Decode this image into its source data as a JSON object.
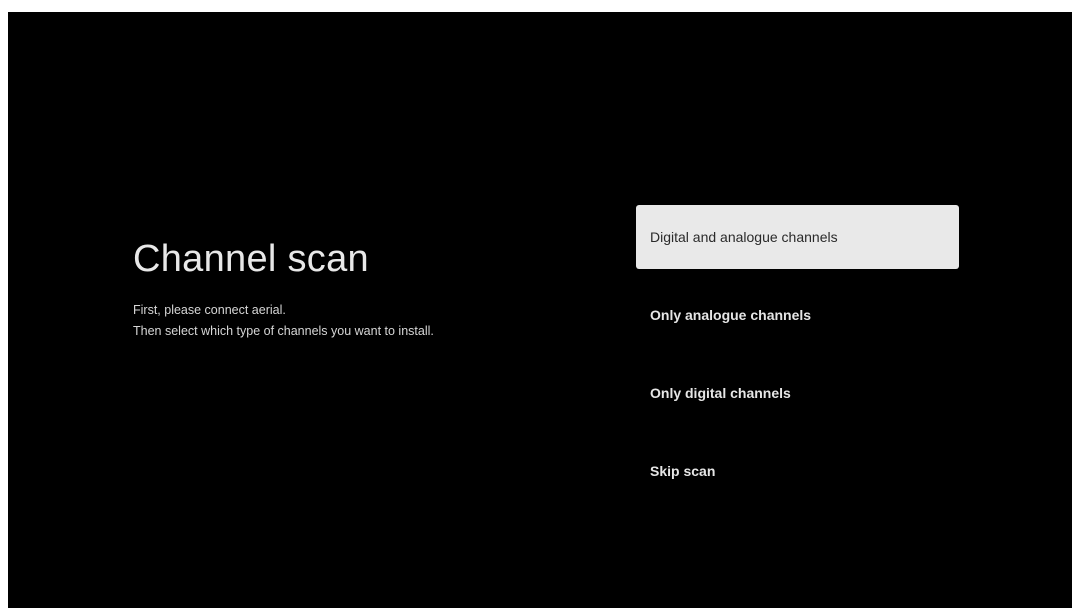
{
  "page": {
    "title": "Channel scan",
    "description_lines": [
      "First, please connect aerial.",
      "Then select which type of channels you want to install."
    ]
  },
  "options": [
    {
      "label": "Digital and analogue channels",
      "selected": true
    },
    {
      "label": "Only analogue channels",
      "selected": false
    },
    {
      "label": "Only digital channels",
      "selected": false
    },
    {
      "label": "Skip scan",
      "selected": false
    }
  ],
  "colors": {
    "background": "#000000",
    "selected_option_bg": "#e9e9e9",
    "text": "#e8e8e8"
  }
}
